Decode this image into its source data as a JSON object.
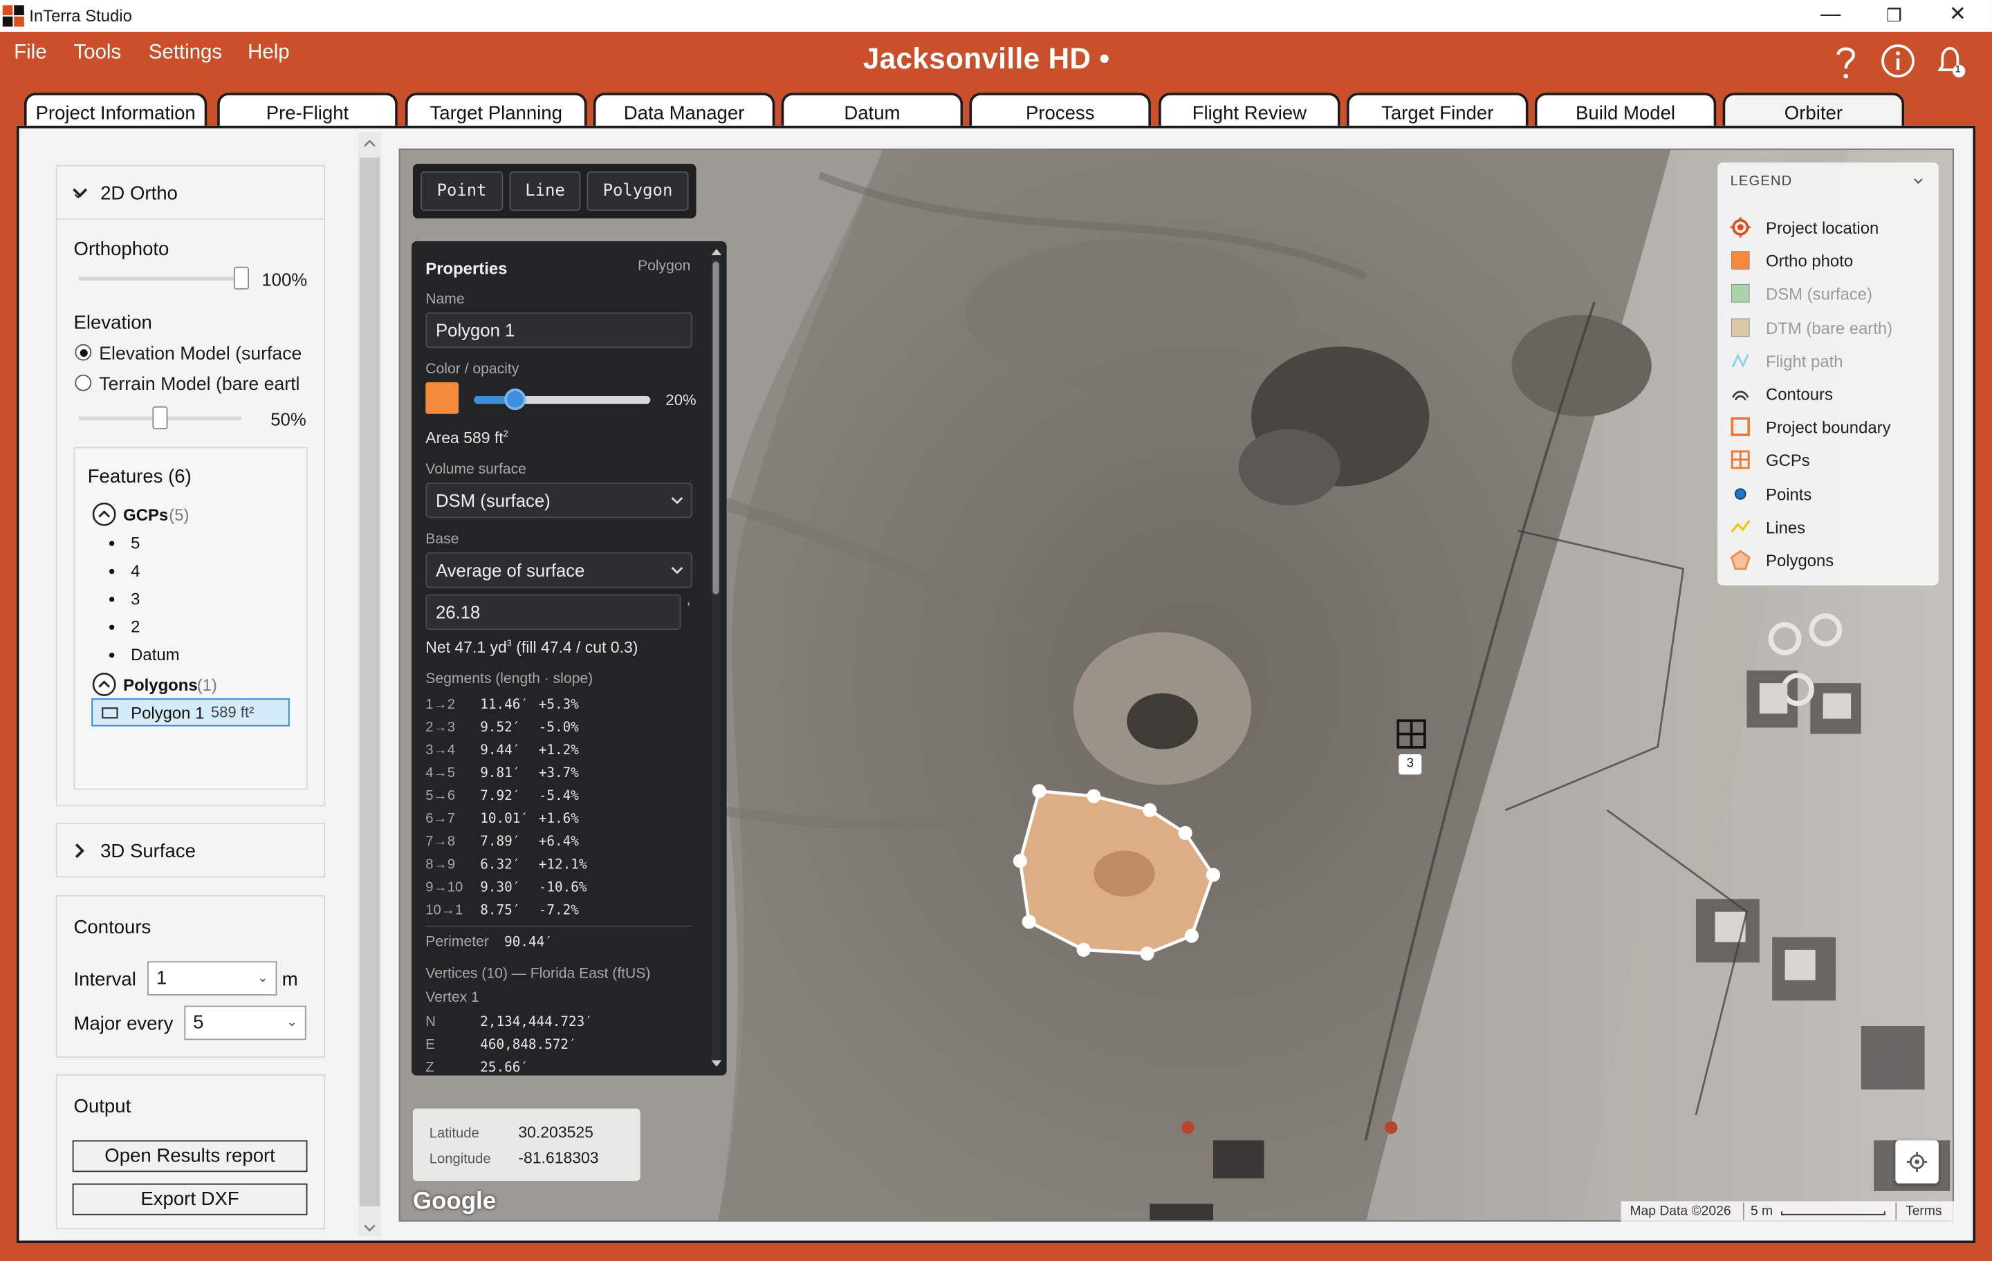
{
  "window": {
    "app_title": "InTerra Studio",
    "minimize": "—",
    "maximize": "❐",
    "close": "✕"
  },
  "menu": [
    "File",
    "Tools",
    "Settings",
    "Help"
  ],
  "project_title": "Jacksonville HD •",
  "header_icons": {
    "help": "?",
    "info": "i",
    "notifications_count": "1"
  },
  "tabs": [
    "Project Information",
    "Pre-Flight",
    "Target Planning",
    "Data Manager",
    "Datum",
    "Process",
    "Flight Review",
    "Target Finder",
    "Build Model",
    "Orbiter"
  ],
  "active_tab": "Orbiter",
  "left_panel": {
    "ortho_section": {
      "title": "2D Ortho",
      "orthophoto_label": "Orthophoto",
      "orthophoto_value": "100%",
      "orthophoto_level": 1.0,
      "elevation_label": "Elevation",
      "elevation_option_1": "Elevation Model (surface",
      "elevation_option_2": "Terrain Model (bare eartl",
      "elevation_value": "50%",
      "elevation_level": 0.5
    },
    "features": {
      "title": "Features (6)",
      "gcps_label": "GCPs",
      "gcps_count": "(5)",
      "gcps": [
        "5",
        "4",
        "3",
        "2",
        "Datum"
      ],
      "polygons_label": "Polygons",
      "polygons_count": "(1)",
      "polygon_item_name": "Polygon 1",
      "polygon_item_area": "589 ft²"
    },
    "surface_section": {
      "title": "3D Surface"
    },
    "contours": {
      "title": "Contours",
      "interval_label": "Interval",
      "interval_value": "1",
      "interval_unit": "m",
      "major_label": "Major every",
      "major_value": "5"
    },
    "output": {
      "title": "Output",
      "open_report": "Open Results report",
      "export_dxf": "Export DXF"
    }
  },
  "map_toolbar": [
    "Point",
    "Line",
    "Polygon"
  ],
  "properties": {
    "title": "Properties",
    "type": "Polygon",
    "name_label": "Name",
    "name_value": "Polygon 1",
    "color_label": "Color / opacity",
    "color": "#f58a3c",
    "opacity_value": "20%",
    "opacity_level": 0.2,
    "area_label": "Area 589 ft",
    "area_sup": "2",
    "volume_label": "Volume surface",
    "volume_value": "DSM (surface)",
    "base_label": "Base",
    "base_value": "Average of surface",
    "base_elev": "26.18",
    "base_elev_mark": "'",
    "net_text": "Net 47.1 yd",
    "net_sup": "3",
    "net_rest": " (fill 47.4 / cut 0.3)",
    "segments_label": "Segments (length · slope)",
    "segments": [
      {
        "id": "1→2",
        "len": "11.46′",
        "slope": "+5.3%"
      },
      {
        "id": "2→3",
        "len": "9.52′",
        "slope": "-5.0%"
      },
      {
        "id": "3→4",
        "len": "9.44′",
        "slope": "+1.2%"
      },
      {
        "id": "4→5",
        "len": "9.81′",
        "slope": "+3.7%"
      },
      {
        "id": "5→6",
        "len": "7.92′",
        "slope": "-5.4%"
      },
      {
        "id": "6→7",
        "len": "10.01′",
        "slope": "+1.6%"
      },
      {
        "id": "7→8",
        "len": "7.89′",
        "slope": "+6.4%"
      },
      {
        "id": "8→9",
        "len": "6.32′",
        "slope": "+12.1%"
      },
      {
        "id": "9→10",
        "len": "9.30′",
        "slope": "-10.6%"
      },
      {
        "id": "10→1",
        "len": "8.75′",
        "slope": "-7.2%"
      }
    ],
    "perimeter_label": "Perimeter",
    "perimeter_value": "90.44′",
    "vertices_label": "Vertices (10) — Florida East (ftUS)",
    "vertex_label": "Vertex 1",
    "vertex": [
      {
        "k": "N",
        "v": "2,134,444.723′"
      },
      {
        "k": "E",
        "v": "460,848.572′"
      },
      {
        "k": "Z",
        "v": "25.66′"
      }
    ]
  },
  "legend": {
    "title": "LEGEND",
    "items": [
      {
        "label": "Project location",
        "icon": "target-icon",
        "color": "#d9501e",
        "dim": false
      },
      {
        "label": "Ortho photo",
        "icon": "square-icon",
        "color": "#f58a3c",
        "dim": false
      },
      {
        "label": "DSM (surface)",
        "icon": "square-icon",
        "color": "#a9d3a9",
        "dim": true
      },
      {
        "label": "DTM (bare earth)",
        "icon": "square-icon",
        "color": "#d9c9a6",
        "dim": true
      },
      {
        "label": "Flight path",
        "icon": "zigzag-icon",
        "color": "#8fd0f0",
        "dim": true
      },
      {
        "label": "Contours",
        "icon": "arc-icon",
        "color": "#333333",
        "dim": false
      },
      {
        "label": "Project boundary",
        "icon": "square-outline-icon",
        "color": "#f07a30",
        "dim": false
      },
      {
        "label": "GCPs",
        "icon": "grid-icon",
        "color": "#f07a30",
        "dim": false
      },
      {
        "label": "Points",
        "icon": "dot-icon",
        "color": "#1a78c8",
        "dim": false
      },
      {
        "label": "Lines",
        "icon": "line-icon",
        "color": "#f0c419",
        "dim": false
      },
      {
        "label": "Polygons",
        "icon": "pentagon-icon",
        "color": "#f58a3c",
        "dim": false
      }
    ]
  },
  "gcp_marker_label": "3",
  "coords": {
    "lat_label": "Latitude",
    "lat_value": "30.203525",
    "lon_label": "Longitude",
    "lon_value": "-81.618303"
  },
  "map_footer": {
    "google": "Google",
    "map_data": "Map Data ©2026",
    "scale": "5 m",
    "terms": "Terms"
  }
}
